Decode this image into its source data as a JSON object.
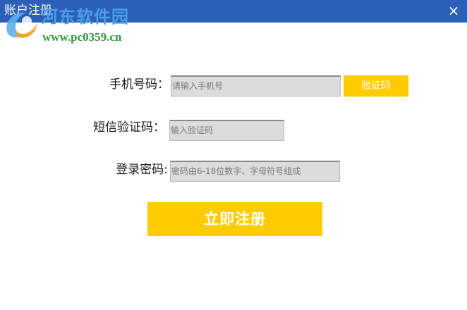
{
  "window": {
    "title": "账户注册",
    "close_glyph": "×"
  },
  "watermark": {
    "name": "河东软件园",
    "url": "www.pc0359.cn",
    "logo_icon": "pc0359-logo-icon"
  },
  "form": {
    "phone_label": "手机号码：",
    "phone_placeholder": "请输入手机号",
    "get_code_label": "验证码",
    "sms_label": "短信验证码：",
    "sms_placeholder": "输入验证码",
    "password_label": "登录密码:",
    "password_placeholder": "密码由6-18位数字、字母符号组成",
    "register_label": "立即注册"
  },
  "colors": {
    "titlebar": "#2c5fb8",
    "accent": "#ffcc00",
    "field_bg": "#dcdcdc"
  }
}
